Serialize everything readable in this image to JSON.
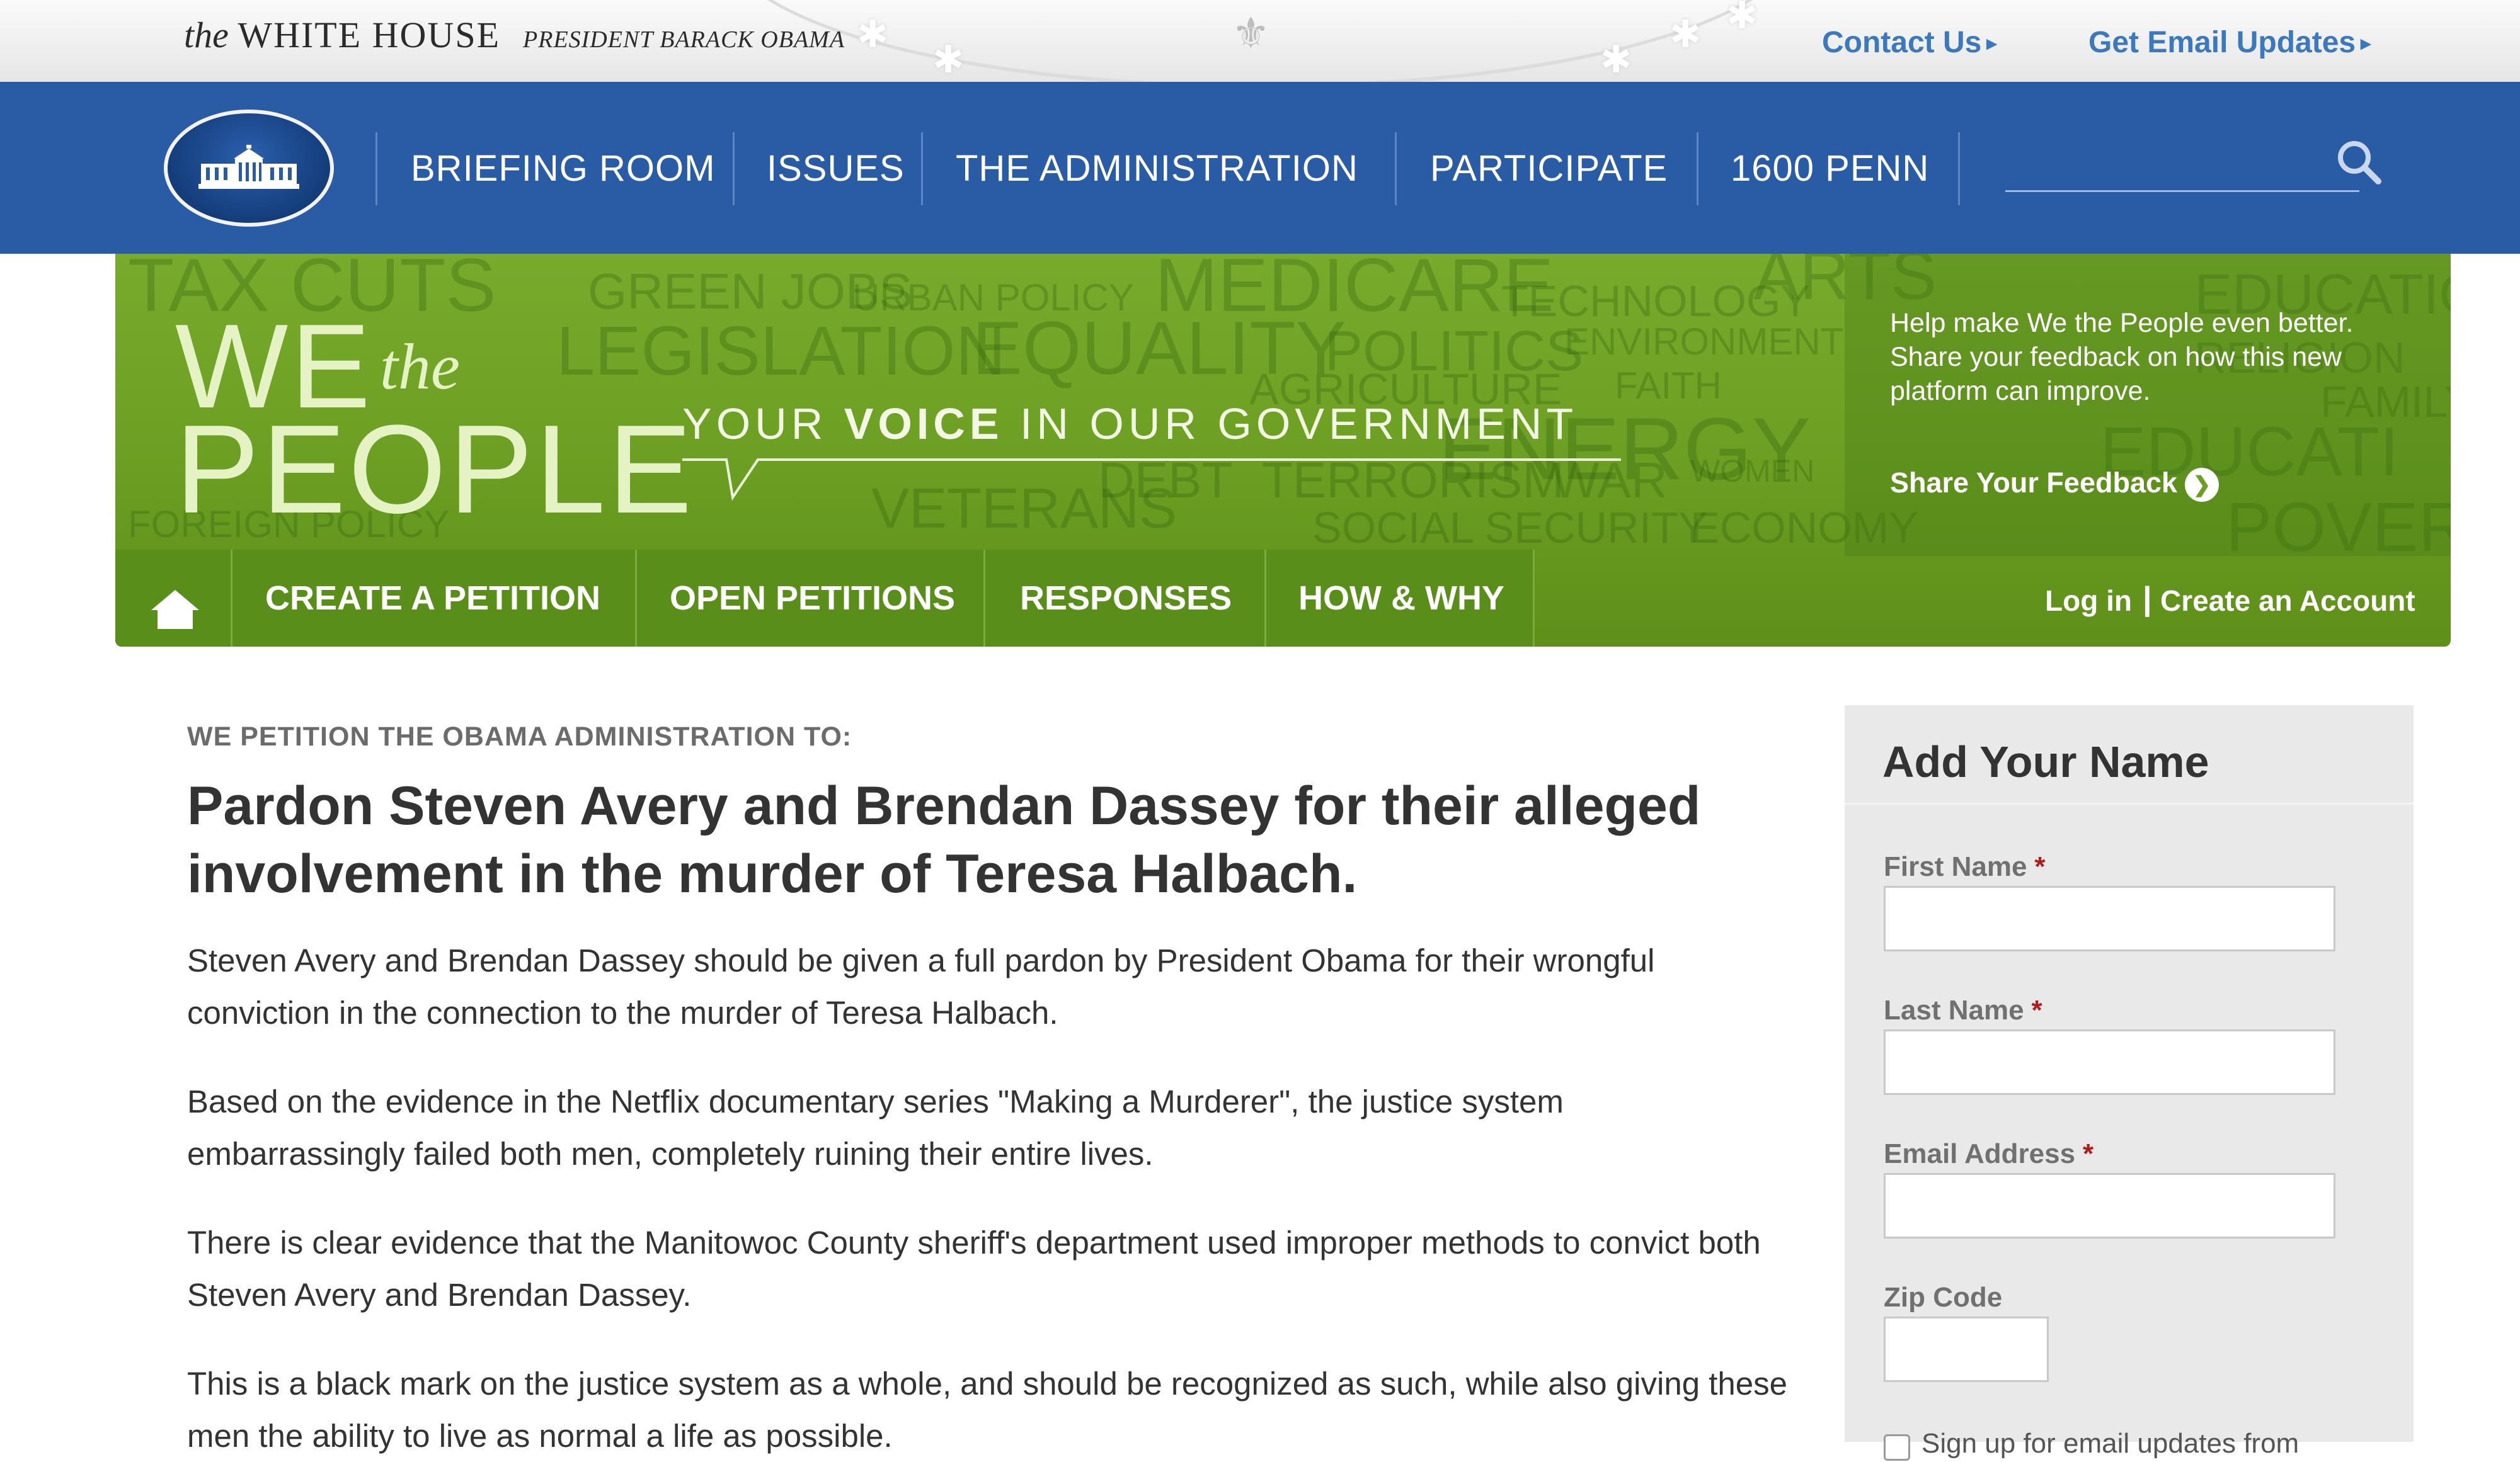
{
  "topbar": {
    "brand_the": "the",
    "brand_wh": "WHITE HOUSE",
    "president": "PRESIDENT BARACK OBAMA",
    "contact": "Contact Us",
    "email_updates": "Get Email Updates",
    "arrow_glyph": "▸"
  },
  "mainnav": {
    "items": [
      "BRIEFING ROOM",
      "ISSUES",
      "THE ADMINISTRATION",
      "PARTICIPATE",
      "1600 PENN"
    ],
    "search_value": ""
  },
  "banner": {
    "we": "WE",
    "the": "the",
    "people": "PEOPLE",
    "tagline_pre": "YOUR ",
    "tagline_bold": "VOICE",
    "tagline_post": " IN OUR GOVERNMENT",
    "feedback_text": "Help make We the People even better. Share your feedback on how this new platform can improve.",
    "feedback_link": "Share Your Feedback"
  },
  "petition_nav": {
    "items": [
      "CREATE A PETITION",
      "OPEN PETITIONS",
      "RESPONSES",
      "HOW & WHY"
    ],
    "login": "Log in",
    "separator": "|",
    "create_account": "Create an Account"
  },
  "petition": {
    "intro": "WE PETITION THE OBAMA ADMINISTRATION TO:",
    "title": "Pardon Steven Avery and Brendan Dassey for their alleged involvement in the murder of Teresa Halbach.",
    "paragraphs": [
      "Steven Avery and Brendan Dassey should be given a full pardon by President Obama for their wrongful conviction in the connection to the murder of Teresa Halbach.",
      "Based on the evidence in the Netflix documentary series \"Making a Murderer\", the justice system embarrassingly failed both men, completely ruining their entire lives.",
      "There is clear evidence that the Manitowoc County sheriff's department used improper methods to convict both Steven Avery and Brendan Dassey.",
      "This is a black mark on the justice system as a whole, and should be recognized as such, while also giving these men the ability to live as normal a life as possible."
    ]
  },
  "form": {
    "title": "Add Your Name",
    "first_name": "First Name",
    "last_name": "Last Name",
    "email": "Email Address",
    "zip": "Zip Code",
    "required": "*",
    "signup": "Sign up for email updates from"
  },
  "colors": {
    "nav_blue": "#2a5ca6",
    "link_blue": "#3b78bd",
    "banner_green": "#6b9e22",
    "required_red": "#b01c1c"
  }
}
